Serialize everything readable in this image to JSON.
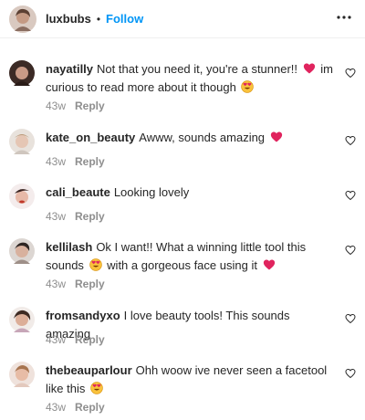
{
  "header": {
    "username": "luxbubs",
    "separator": "•",
    "follow_label": "Follow"
  },
  "comments": [
    {
      "username": "nayatilly",
      "text_1": "Not that you need it, you're a stunner!!",
      "text_2": "im curious to read more about it though",
      "time": "43w",
      "reply_label": "Reply"
    },
    {
      "username": "kate_on_beauty",
      "text_1": "Awww, sounds amazing",
      "time": "43w",
      "reply_label": "Reply"
    },
    {
      "username": "cali_beaute",
      "text_1": "Looking lovely",
      "time": "43w",
      "reply_label": "Reply"
    },
    {
      "username": "kellilash",
      "text_1": "Ok I want!! What a winning little tool this sounds",
      "text_2": "with a gorgeous face using it",
      "time": "43w",
      "reply_label": "Reply"
    },
    {
      "username": "fromsandyxo",
      "text_1": "I love beauty tools! This sounds amazing",
      "time": "43w",
      "reply_label": "Reply"
    },
    {
      "username": "thebeauparlour",
      "text_1": "Ohh woow ive never seen a facetool like this",
      "time": "43w",
      "reply_label": "Reply"
    }
  ],
  "icons": {
    "like": "heart-outline-icon",
    "more": "more-options-icon",
    "red_heart": "red-heart-emoji",
    "heart_eyes": "heart-eyes-emoji"
  },
  "colors": {
    "follow_blue": "#0095f6",
    "muted": "#8e8e8e",
    "text": "#262626",
    "heart_red": "#e0245e"
  }
}
